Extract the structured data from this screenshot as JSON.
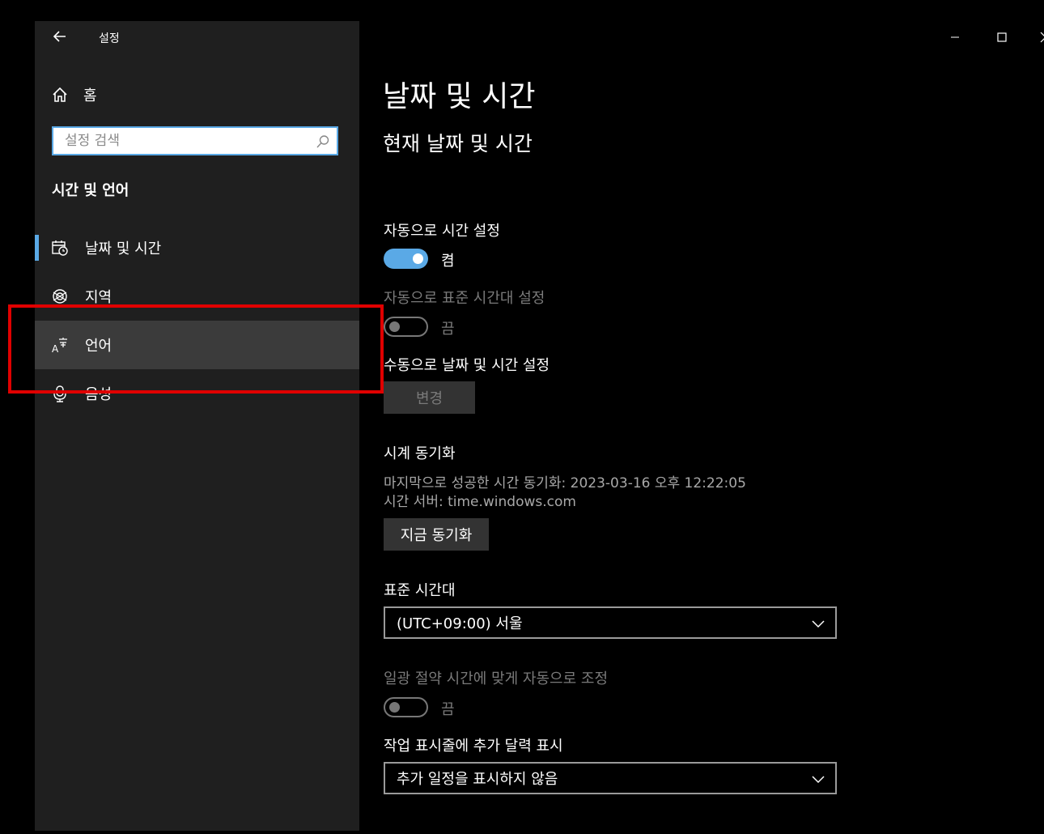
{
  "window": {
    "title": "설정"
  },
  "sidebar": {
    "home_label": "홈",
    "search_placeholder": "설정 검색",
    "section_heading": "시간 및 언어",
    "items": [
      {
        "label": "날짜 및 시간",
        "icon": "calendar-clock-icon",
        "selected": true
      },
      {
        "label": "지역",
        "icon": "globe-icon",
        "selected": false
      },
      {
        "label": "언어",
        "icon": "language-icon",
        "selected": false
      },
      {
        "label": "음성",
        "icon": "microphone-icon",
        "selected": false
      }
    ]
  },
  "main": {
    "page_title": "날짜 및 시간",
    "section_title": "현재 날짜 및 시간",
    "auto_time": {
      "label": "자동으로 시간 설정",
      "state": "켬"
    },
    "auto_timezone": {
      "label": "자동으로 표준 시간대 설정",
      "state": "끔"
    },
    "manual": {
      "label": "수동으로 날짜 및 시간 설정",
      "button": "변경"
    },
    "sync": {
      "heading": "시계 동기화",
      "last_sync": "마지막으로 성공한 시간 동기화: 2023-03-16 오후 12:22:05",
      "server": "시간 서버: time.windows.com",
      "button": "지금 동기화"
    },
    "timezone": {
      "label": "표준 시간대",
      "value": "(UTC+09:00) 서울"
    },
    "dst": {
      "label": "일광 절약 시간에 맞게 자동으로 조정",
      "state": "끔"
    },
    "calendar": {
      "label": "작업 표시줄에 추가 달력 표시",
      "value": "추가 일정을 표시하지 않음"
    }
  },
  "colors": {
    "accent": "#5aa9e6",
    "highlight": "#e00000",
    "sidebar_bg": "#1f1f1f"
  }
}
